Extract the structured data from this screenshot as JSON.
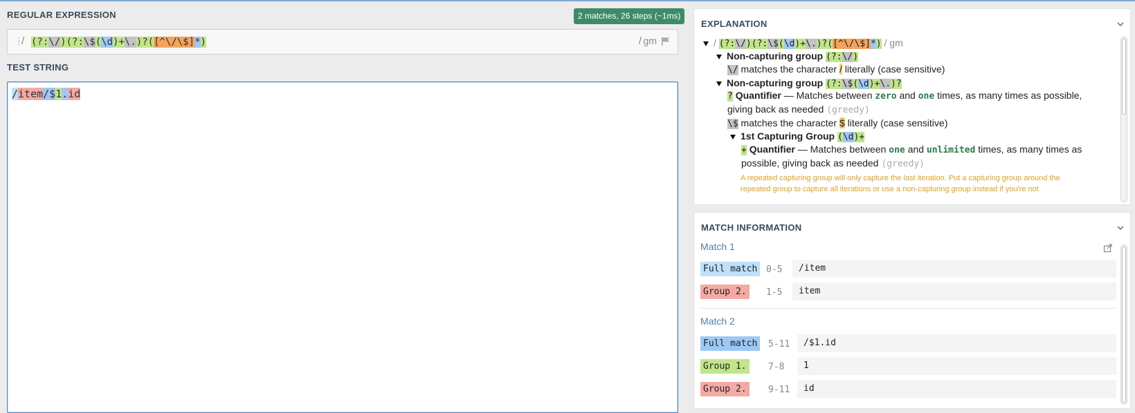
{
  "regex_section": {
    "title": "REGULAR EXPRESSION",
    "status_badge": "2 matches, 26 steps (~1ms)",
    "delimiter_open": "/",
    "delimiter_close": "/",
    "flags": "gm",
    "tokens": [
      "(?:",
      "\\/",
      ")",
      "(?:",
      "\\$",
      "(",
      "\\d",
      ")+",
      "\\.",
      ")?",
      "(",
      "[^\\/\\$]",
      "*",
      ")"
    ]
  },
  "test_section": {
    "title": "TEST STRING",
    "parts": [
      "/",
      "item",
      "/$",
      "1",
      ".",
      "id"
    ]
  },
  "explanation": {
    "title": "EXPLANATION",
    "root": {
      "delim_open": "/",
      "delim_close": "/",
      "flags": "gm",
      "tokens": [
        "(?:",
        "\\/",
        ")",
        "(?:",
        "\\$",
        "(",
        "\\d",
        ")+",
        "\\.",
        ")?",
        "(",
        "[^\\/\\$]",
        "*",
        ")"
      ]
    },
    "group1": {
      "title": "Non-capturing group",
      "tokens": [
        "(?:",
        "\\/",
        ")"
      ]
    },
    "line1": {
      "token": "\\/",
      "text_a": "matches the character",
      "char": "/",
      "text_b": "literally (case sensitive)"
    },
    "group2": {
      "title": "Non-capturing group",
      "tokens": [
        "(?:",
        "\\$",
        "(",
        "\\d",
        ")+",
        "\\.",
        ")?"
      ]
    },
    "quantifier1": {
      "token": "?",
      "label": "Quantifier",
      "text_a": "— Matches between",
      "code_a": "zero",
      "text_b": "and",
      "code_b": "one",
      "text_c": "times, as many times as possible,",
      "text_d": "giving back as needed",
      "greedy": "(greedy)"
    },
    "line2": {
      "token": "\\$",
      "text_a": "matches the character",
      "char": "$",
      "text_b": "literally (case sensitive)"
    },
    "capgroup1": {
      "title": "1st Capturing Group",
      "tokens": [
        "(",
        "\\d",
        ")+"
      ]
    },
    "quantifier2": {
      "token": "+",
      "label": "Quantifier",
      "text_a": "— Matches between",
      "code_a": "one",
      "text_b": "and",
      "code_b": "unlimited",
      "text_c": "times, as many times as",
      "text_d": "possible, giving back as needed",
      "greedy": "(greedy)"
    },
    "warning_line1": "A repeated capturing group will only capture the last iteration. Put a capturing group around the",
    "warning_line2": "repeated group to capture all iterations or use a non-capturing group instead if you're not"
  },
  "match_info": {
    "title": "MATCH INFORMATION",
    "matches": [
      {
        "title": "Match 1",
        "rows": [
          {
            "label": "Full match",
            "range": "0-5",
            "value": "/item"
          },
          {
            "label": "Group 2.",
            "range": "1-5",
            "value": "item"
          }
        ]
      },
      {
        "title": "Match 2",
        "rows": [
          {
            "label": "Full match",
            "range": "5-11",
            "value": "/$1.id"
          },
          {
            "label": "Group 1.",
            "range": "7-8",
            "value": "1"
          },
          {
            "label": "Group 2.",
            "range": "9-11",
            "value": "id"
          }
        ]
      }
    ]
  },
  "colors": {
    "badge": "#3d8c67",
    "group_green": "#c1e58a",
    "escape_grey": "#c3c3c3",
    "class_blue": "#9ec8f4",
    "charset_orange": "#f2a45b",
    "full_match_light_blue": "#bde0fb",
    "group2_red": "#f4aaa4",
    "focus_border": "#4a86c4"
  }
}
